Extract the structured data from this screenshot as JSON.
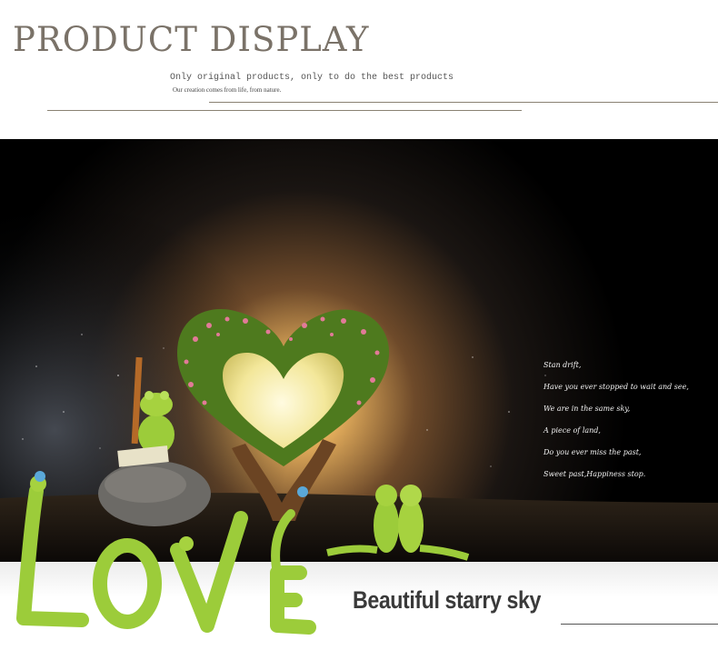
{
  "header": {
    "title": "PRODUCT DISPLAY",
    "subtitle": "Only original products, only to do the best products",
    "tagline": "Our creation comes from life, from nature."
  },
  "scene": {
    "poem": [
      "Stan drift,",
      "Have you ever stopped to wait and see,",
      "We are in the same sky,",
      "A piece of land,",
      "Do you ever miss the past,",
      "Sweet past,Happiness stop."
    ]
  },
  "caption": {
    "text": "Beautiful starry sky"
  },
  "colors": {
    "title": "#7a7268",
    "rule": "#8a8273",
    "caption": "#3a3a3a",
    "frog": "#9ccc3a"
  }
}
